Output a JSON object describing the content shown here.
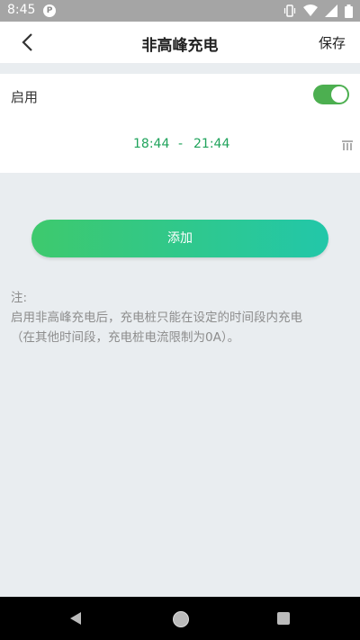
{
  "status_bar": {
    "time": "8:45",
    "app_badge": "P"
  },
  "header": {
    "title": "非高峰充电",
    "save_label": "保存"
  },
  "schedule": {
    "enable_label": "启用",
    "enabled": true,
    "start_time": "18:44",
    "separator": "-",
    "end_time": "21:44"
  },
  "actions": {
    "add_label": "添加"
  },
  "note": {
    "heading": "注:",
    "line1": "启用非高峰充电后，充电桩只能在设定的时间段内充电",
    "line2": "（在其他时间段，充电桩电流限制为0A）。"
  },
  "colors": {
    "accent_green": "#4caf50",
    "time_green": "#1fa35b",
    "button_gradient_start": "#3ec96d",
    "button_gradient_end": "#22c7a9"
  }
}
